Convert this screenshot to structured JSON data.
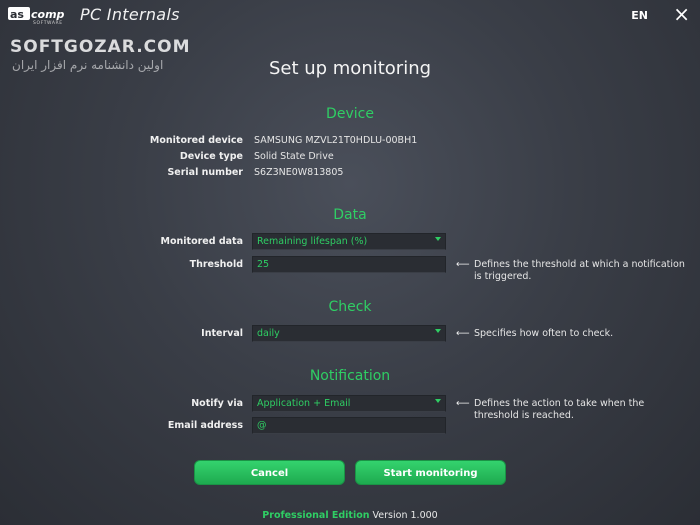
{
  "titlebar": {
    "logo_text": "ascomp",
    "logo_sub": "SOFTWARE",
    "app_title": "PC Internals",
    "language": "EN",
    "close_symbol": "×"
  },
  "watermark": {
    "line1": "SOFTGOZAR.COM",
    "line2": "اولین دانشنامه نرم افزار ایران"
  },
  "page_title": "Set up monitoring",
  "device": {
    "heading": "Device",
    "monitored_device_label": "Monitored device",
    "monitored_device_value": "SAMSUNG MZVL21T0HDLU-00BH1",
    "device_type_label": "Device type",
    "device_type_value": "Solid State Drive",
    "serial_label": "Serial number",
    "serial_value": "S6Z3NE0W813805"
  },
  "data_section": {
    "heading": "Data",
    "monitored_data_label": "Monitored data",
    "monitored_data_value": "Remaining lifespan (%)",
    "threshold_label": "Threshold",
    "threshold_value": "25",
    "threshold_hint": "Defines the threshold at which a notification is triggered."
  },
  "check": {
    "heading": "Check",
    "interval_label": "Interval",
    "interval_value": "daily",
    "interval_hint": "Specifies how often to check."
  },
  "notification": {
    "heading": "Notification",
    "notify_label": "Notify via",
    "notify_value": "Application + Email",
    "notify_hint": "Defines the action to take when the threshold is reached.",
    "email_label": "Email address",
    "email_value": "@"
  },
  "hint_arrow": "⟵",
  "buttons": {
    "cancel": "Cancel",
    "start": "Start monitoring"
  },
  "footer": {
    "edition": "Professional Edition",
    "version": "Version 1.000"
  },
  "colors": {
    "accent": "#2fce64",
    "background": "#3a3e47"
  }
}
